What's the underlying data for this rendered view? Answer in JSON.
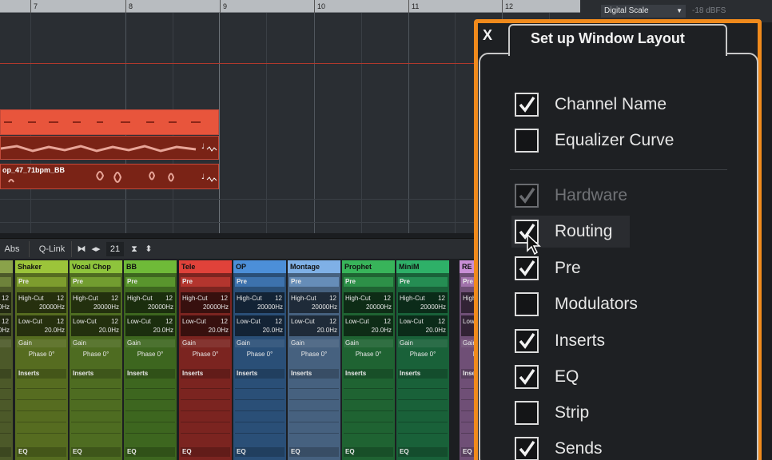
{
  "ruler": {
    "marks": [
      "7",
      "8",
      "9",
      "10",
      "11",
      "12"
    ]
  },
  "meter": {
    "scale_label": "Digital Scale",
    "scale_value": "-18 dBFS"
  },
  "arrange": {
    "clip_label": "op_47_71bpm_BB"
  },
  "toolbar": {
    "abs_label": "Abs",
    "qlink_label": "Q-Link",
    "channel_count": "21"
  },
  "mixer": {
    "labels": {
      "pre": "Pre",
      "highcut": "High-Cut",
      "highcut_value": "20000Hz",
      "lowcut": "Low-Cut",
      "lowcut_value": "20.0Hz",
      "lvl": "12",
      "gain": "Gain",
      "phase": "Phase 0°",
      "inserts": "Inserts",
      "eq": "EQ"
    },
    "channels": [
      {
        "name": "",
        "color": "#8aa24a"
      },
      {
        "name": "Shaker",
        "color": "#9cc43a"
      },
      {
        "name": "Vocal Chop",
        "color": "#8ec43c"
      },
      {
        "name": "BB",
        "color": "#6fba38"
      },
      {
        "name": "Tele",
        "color": "#e0423a"
      },
      {
        "name": "OP",
        "color": "#4c8fd8"
      },
      {
        "name": "Montage",
        "color": "#7fb0e6"
      },
      {
        "name": "Prophet",
        "color": "#38b45a"
      },
      {
        "name": "MiniM",
        "color": "#2eb068"
      },
      {
        "name": "RE",
        "color": "#c98fd6"
      }
    ]
  },
  "panel": {
    "title": "Set up Window Layout",
    "close_label": "X",
    "options": [
      {
        "label": "Channel Name",
        "checked": true,
        "disabled": false
      },
      {
        "label": "Equalizer Curve",
        "checked": false,
        "disabled": false
      },
      {
        "label": "Hardware",
        "checked": true,
        "disabled": true
      },
      {
        "label": "Routing",
        "checked": true,
        "disabled": false
      },
      {
        "label": "Pre",
        "checked": true,
        "disabled": false
      },
      {
        "label": "Modulators",
        "checked": false,
        "disabled": false
      },
      {
        "label": "Inserts",
        "checked": true,
        "disabled": false
      },
      {
        "label": "EQ",
        "checked": true,
        "disabled": false
      },
      {
        "label": "Strip",
        "checked": false,
        "disabled": false
      },
      {
        "label": "Sends",
        "checked": true,
        "disabled": false
      }
    ]
  }
}
